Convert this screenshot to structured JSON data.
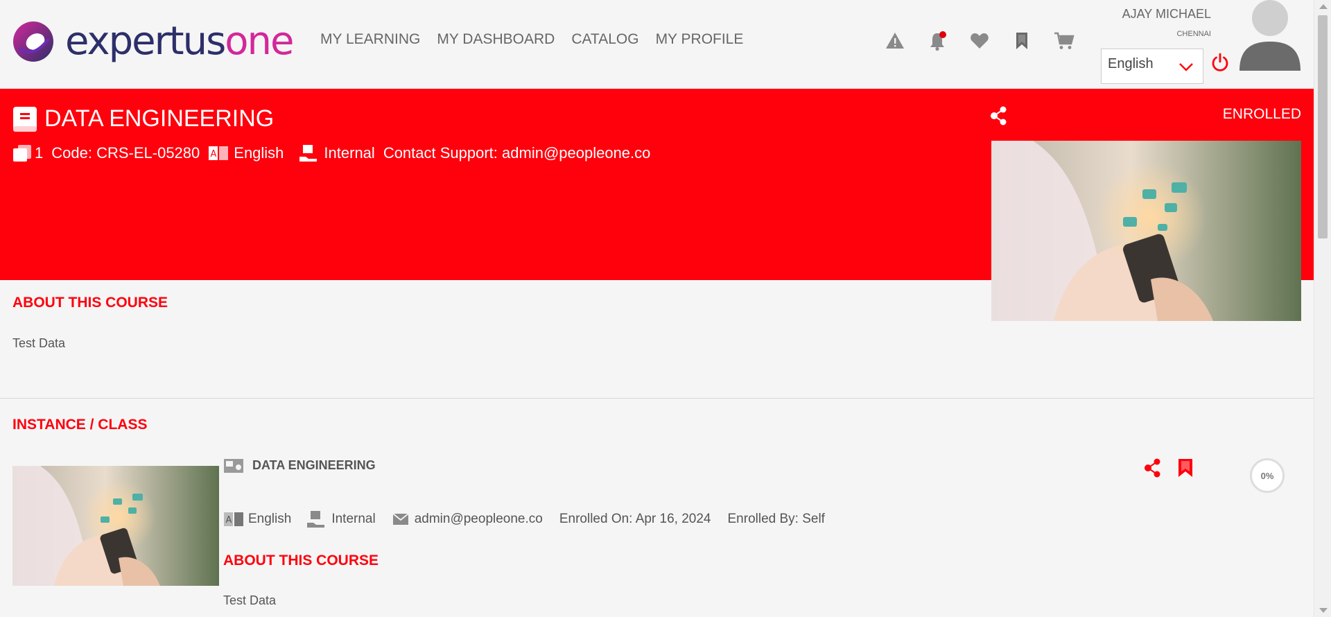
{
  "brand": {
    "logo_part1": "expertus",
    "logo_part2": "one"
  },
  "nav": {
    "items": [
      {
        "label": "MY LEARNING"
      },
      {
        "label": "MY DASHBOARD"
      },
      {
        "label": "CATALOG"
      },
      {
        "label": "MY PROFILE"
      }
    ]
  },
  "header_icons": [
    "alert-icon",
    "bell-icon",
    "heart-icon",
    "bookmark-icon",
    "cart-icon"
  ],
  "user": {
    "name": "AJAY MICHAEL",
    "location": "CHENNAI"
  },
  "language_select": {
    "value": "English"
  },
  "course": {
    "title": "DATA ENGINEERING",
    "sessions": "1",
    "code": "Code: CRS-EL-05280",
    "language": "English",
    "type": "Internal",
    "support": "Contact Support: admin@peopleone.co",
    "status": "ENROLLED"
  },
  "about": {
    "heading": "ABOUT THIS COURSE",
    "text": "Test Data"
  },
  "instance": {
    "heading": "INSTANCE / CLASS",
    "title": "DATA ENGINEERING",
    "language": "English",
    "type": "Internal",
    "email": "admin@peopleone.co",
    "enrolled_on": "Enrolled On: Apr 16, 2024",
    "enrolled_by": "Enrolled By: Self",
    "progress": "0%",
    "about_heading": "ABOUT THIS COURSE",
    "about_text": "Test Data"
  },
  "colors": {
    "accent": "#ff000d",
    "brand_navy": "#2d2f6a",
    "brand_pink": "#d2289a"
  }
}
